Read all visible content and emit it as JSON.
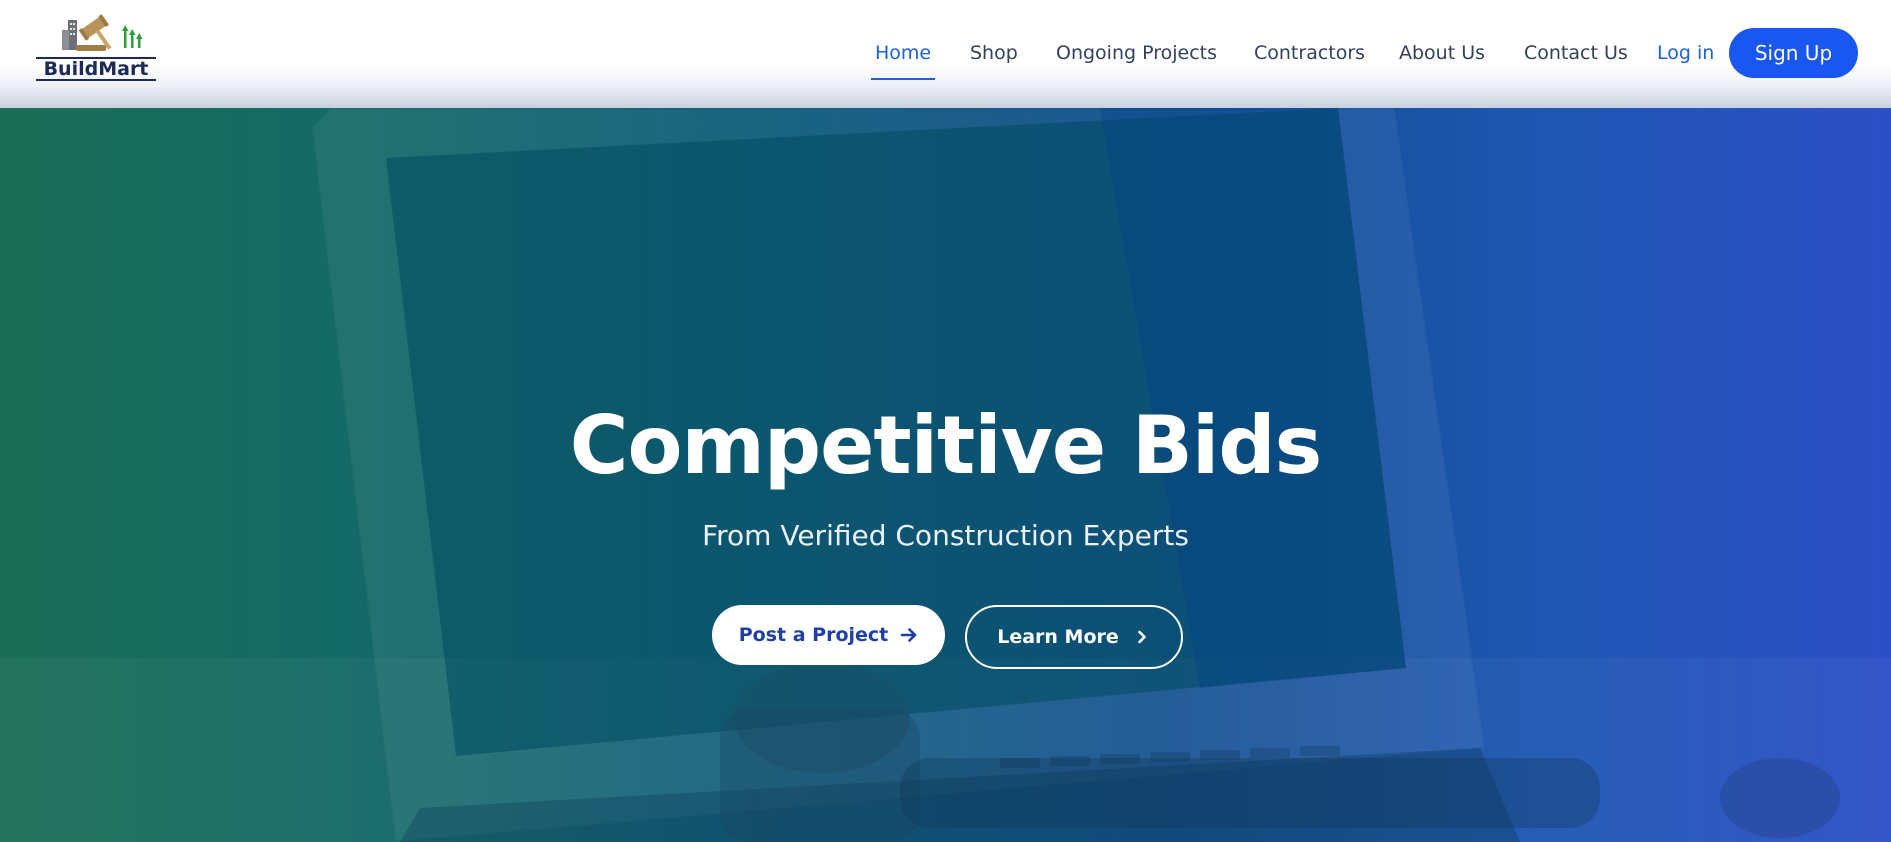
{
  "brand": {
    "name": "BuildMart",
    "logo_icon": "gavel-buildings-logo",
    "colors": {
      "navy": "#1c2b55",
      "gold": "#b8935a",
      "green": "#2e9e3e"
    }
  },
  "nav": {
    "items": [
      {
        "label": "Home",
        "active": true
      },
      {
        "label": "Shop",
        "active": false
      },
      {
        "label": "Ongoing Projects",
        "active": false
      },
      {
        "label": "Contractors",
        "active": false
      },
      {
        "label": "About Us",
        "active": false
      },
      {
        "label": "Contact Us",
        "active": false
      }
    ],
    "login_label": "Log in",
    "signup_label": "Sign Up"
  },
  "hero": {
    "title": "Competitive Bids",
    "subtitle": "From Verified Construction Experts",
    "primary_button": {
      "label": "Post a Project",
      "icon": "arrow-right-icon"
    },
    "secondary_button": {
      "label": "Learn More",
      "icon": "chevron-right-icon"
    },
    "background_image": "laptop-with-gavel"
  },
  "colors": {
    "accent": "#1e5fe0",
    "signup_bg": "#1a56f0",
    "hero_gradient_start": "#1b6e55",
    "hero_gradient_end": "#2c4fc6",
    "primary_button_text": "#1f3fa8"
  }
}
